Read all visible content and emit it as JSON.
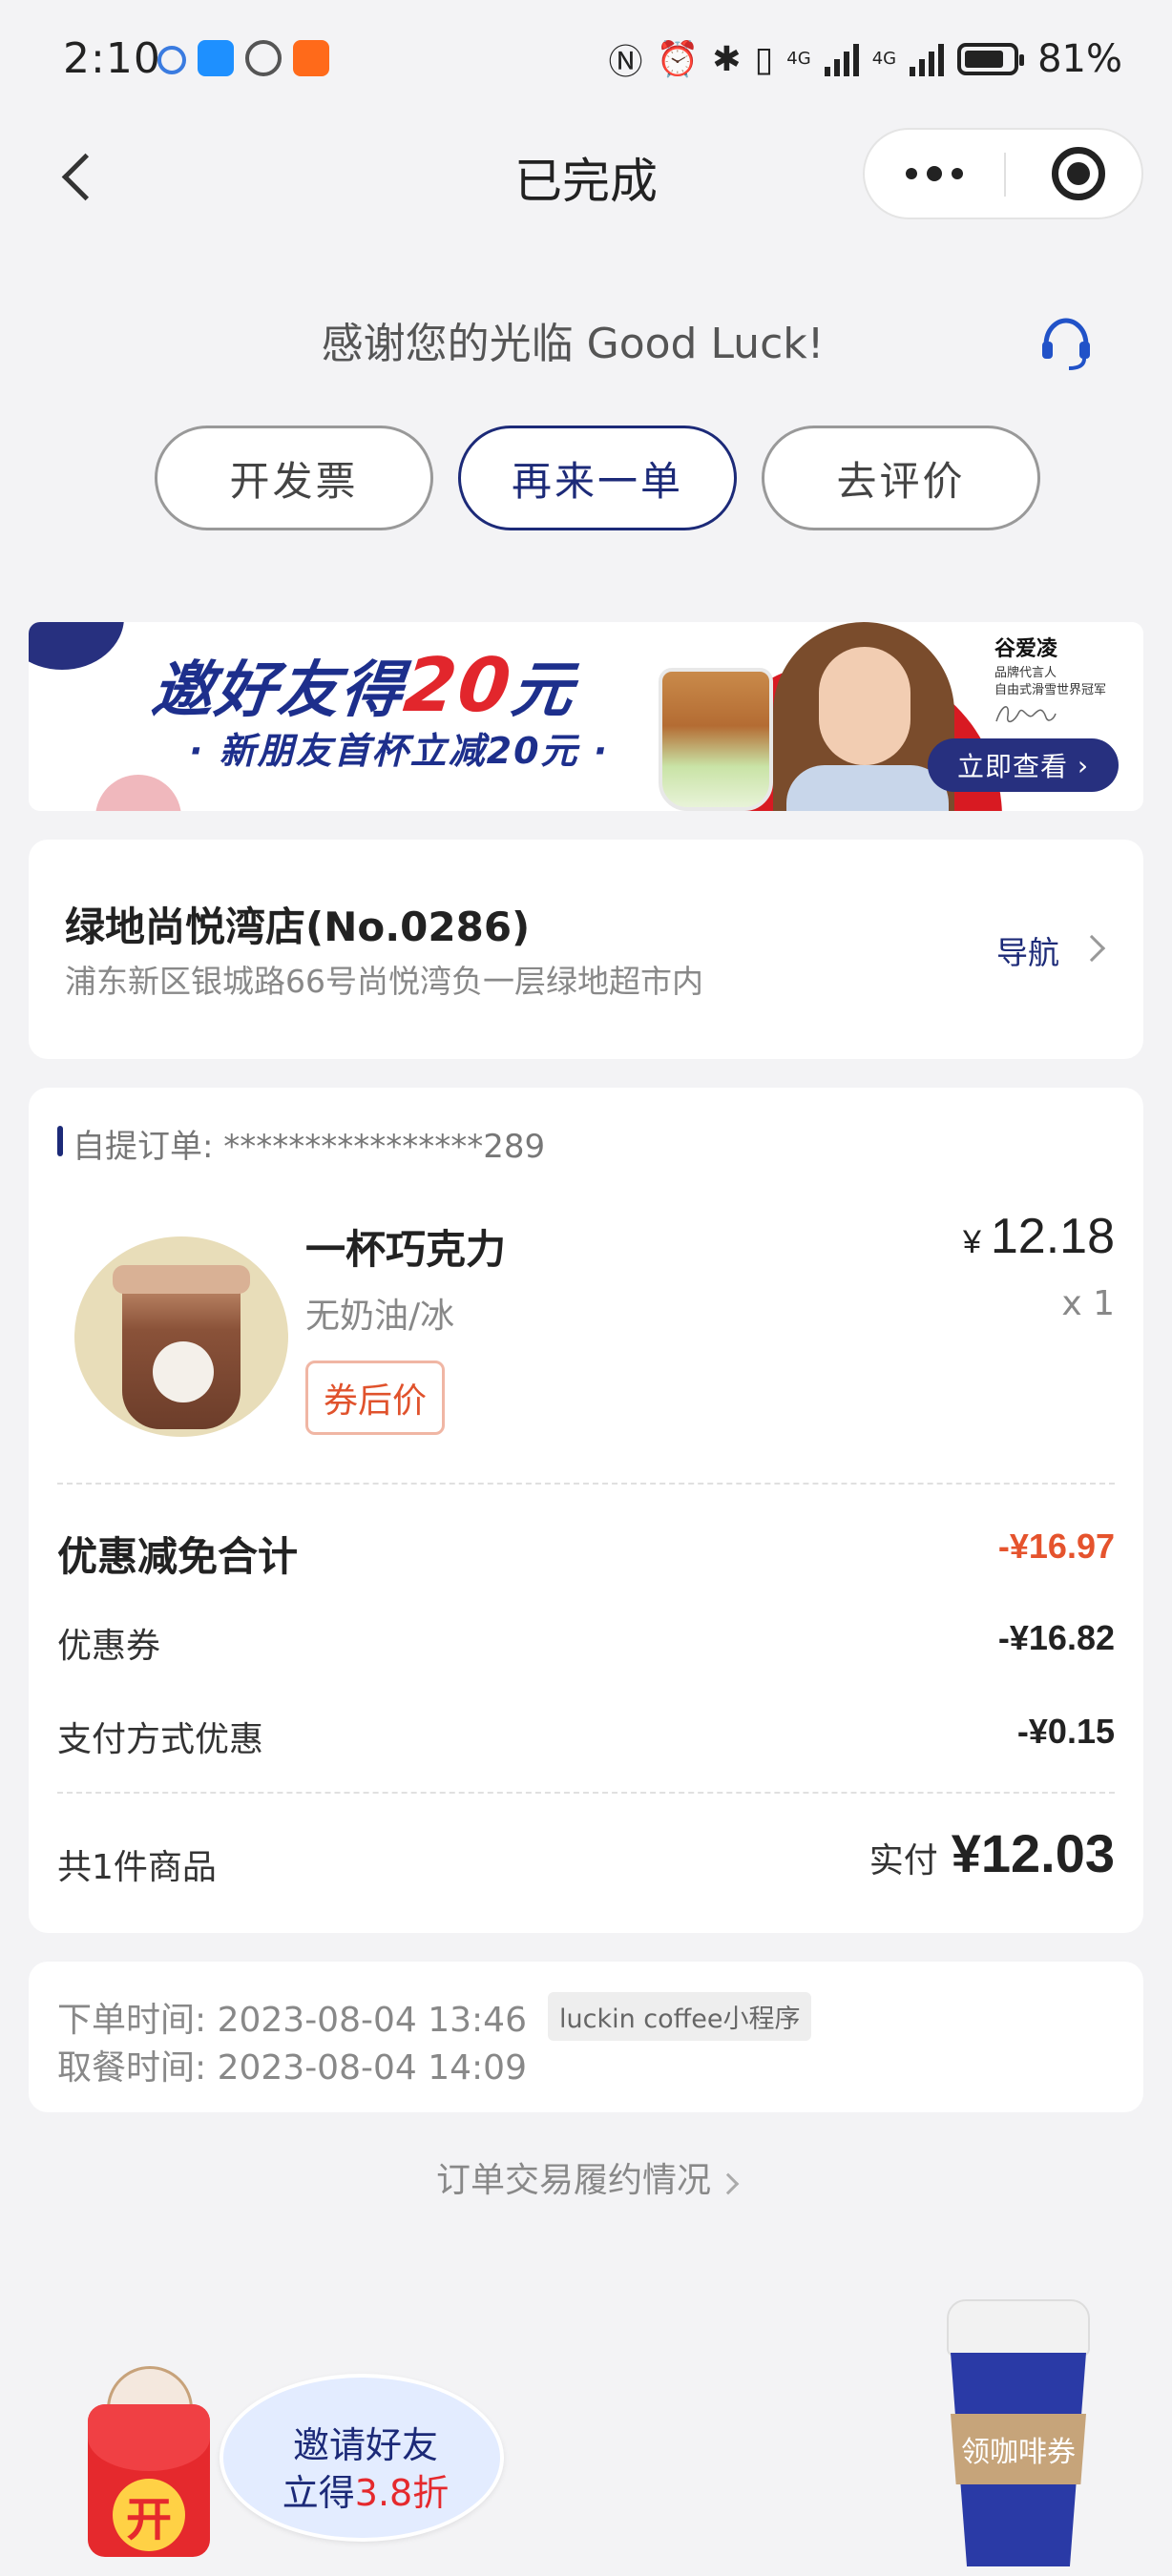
{
  "status_bar": {
    "time": "2:10",
    "network_1": "4G",
    "network_2": "4G",
    "battery": "81%",
    "icons": [
      "chat-icon",
      "app-icon",
      "hand-icon",
      "taobao-icon",
      "nfc-icon",
      "alarm-icon",
      "bluetooth-icon",
      "vibrate-icon",
      "signal-icon",
      "battery-icon"
    ]
  },
  "nav": {
    "title": "已完成",
    "back_icon": "chevron-left-icon",
    "menu_icon": "more-dots-icon",
    "close_icon": "target-icon"
  },
  "thanks_text": "感谢您的光临 Good Luck!",
  "support_icon": "headset-icon",
  "actions": {
    "invoice": "开发票",
    "reorder": "再来一单",
    "review": "去评价"
  },
  "banner": {
    "title_prefix": "邀好友得",
    "title_num": "20",
    "title_suffix": "元",
    "subtitle": "· 新朋友首杯立减20元 ·",
    "endorser_name": "谷爱凌",
    "endorser_line1": "品牌代言人",
    "endorser_line2": "自由式滑雪世界冠军",
    "cta": "立即查看"
  },
  "store": {
    "name": "绿地尚悦湾店(No.0286)",
    "address": "浦东新区银城路66号尚悦湾负一层绿地超市内",
    "nav_label": "导航"
  },
  "order": {
    "label": "自提订单: ****************289",
    "item": {
      "name": "一杯巧克力",
      "spec": "无奶油/冰",
      "tag": "券后价",
      "price_symbol": "¥",
      "price": "12.18",
      "quantity": "x 1"
    },
    "discount_total_label": "优惠减免合计",
    "discount_total_value": "-¥16.97",
    "coupon_label": "优惠券",
    "coupon_value": "-¥16.82",
    "payment_discount_label": "支付方式优惠",
    "payment_discount_value": "-¥0.15",
    "item_count": "共1件商品",
    "paid_label": "实付",
    "paid_value": "¥12.03"
  },
  "times": {
    "order_time": "下单时间: 2023-08-04 13:46",
    "source": "luckin coffee小程序",
    "pickup_time": "取餐时间: 2023-08-04 14:09"
  },
  "fulfillment_link": "订单交易履约情况",
  "floating": {
    "redpacket_char": "开",
    "invite_line1": "邀请好友",
    "invite_line2_prefix": "立得",
    "invite_line2_highlight": "3.8折",
    "coffee_coupon": "领咖啡券"
  },
  "colors": {
    "brand_blue": "#1c2a78",
    "discount_red": "#e5532d",
    "background": "#f3f3f5"
  }
}
